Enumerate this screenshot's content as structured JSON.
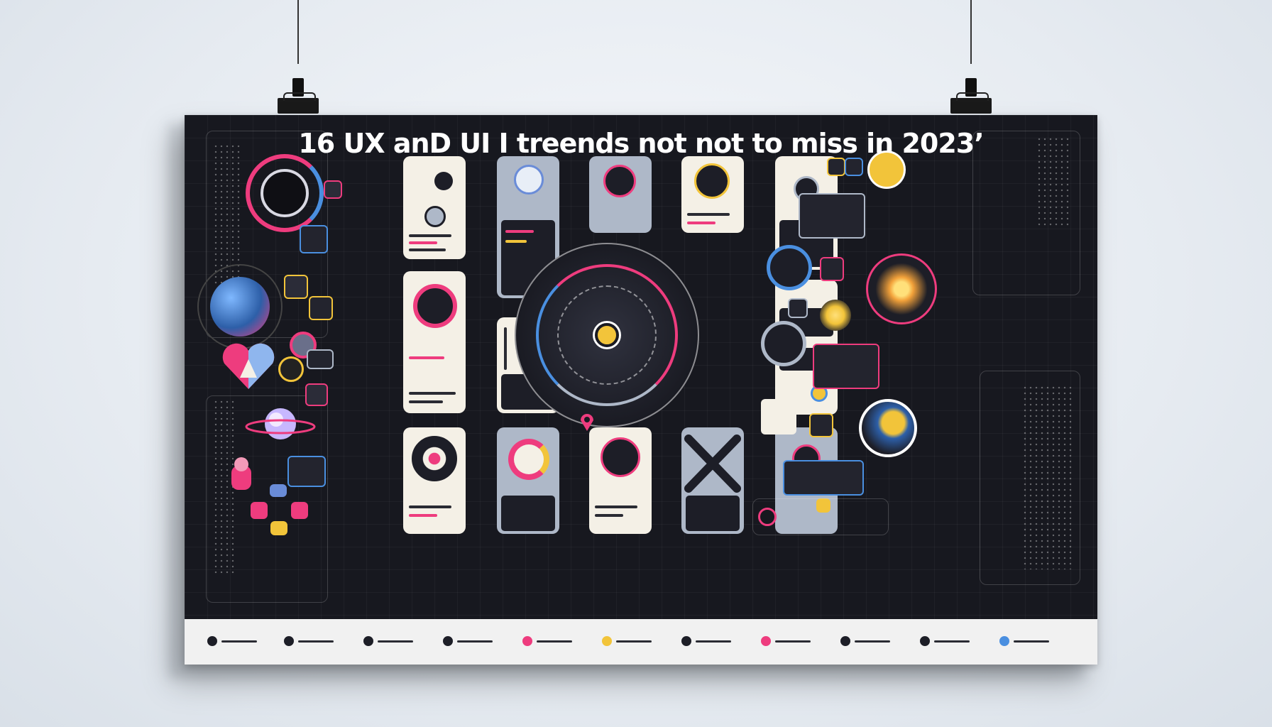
{
  "poster": {
    "title": "16 UX anD UI I treends not not to miss in 2023’"
  },
  "colors": {
    "background": "#17181f",
    "accent_pink": "#ee3c7e",
    "accent_yellow": "#f2c43a",
    "accent_blue": "#4a8fe0",
    "card_light": "#f4f0e6",
    "card_gray": "#aeb8c8"
  },
  "icons": {
    "hub": "radar-target-icon",
    "globe": "globe-icon",
    "heart": "heart-icon",
    "planet": "planet-icon",
    "mascot": "robot-icon",
    "map_globe": "world-map-icon",
    "hanging_clip": "binder-clip-icon"
  },
  "footer_items": 11
}
